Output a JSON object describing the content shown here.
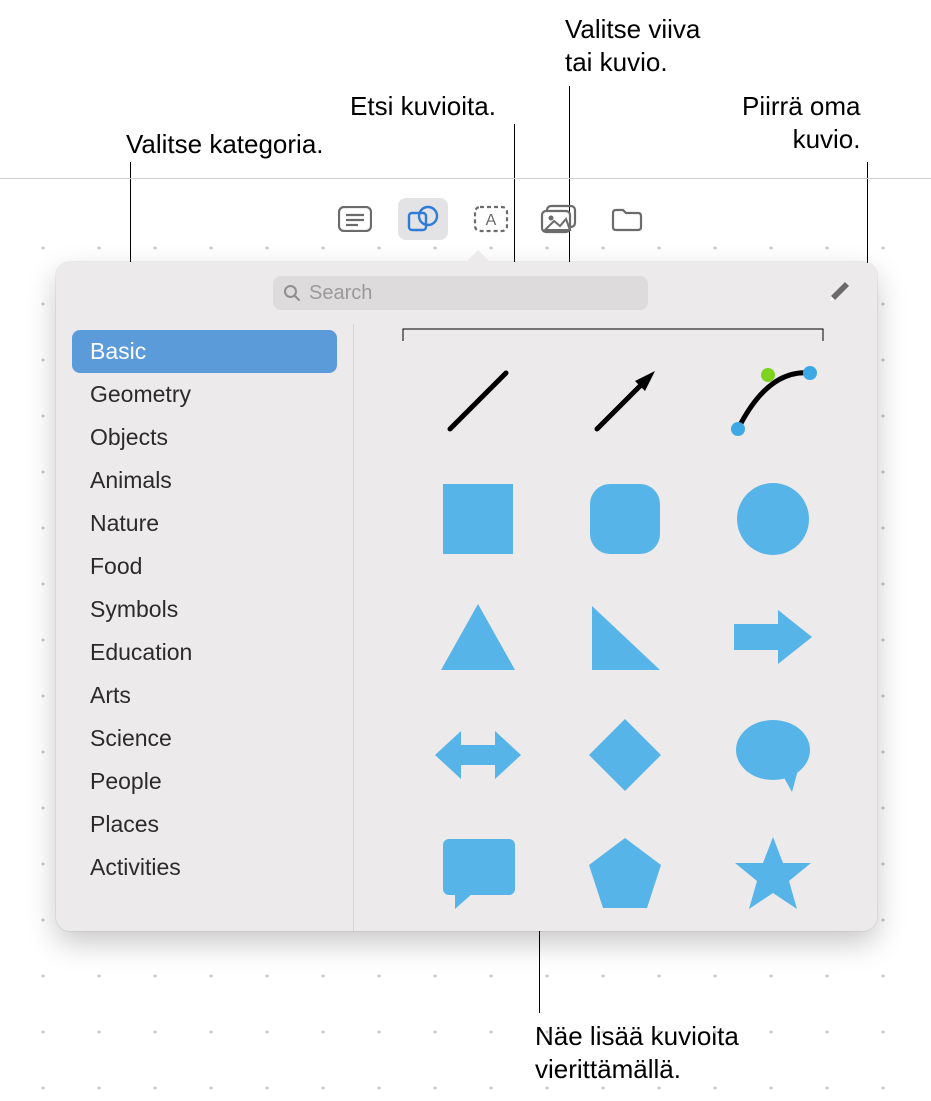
{
  "callouts": {
    "select_category": "Valitse kategoria.",
    "search_shapes": "Etsi kuvioita.",
    "select_line_or_shape": "Valitse viiva\ntai kuvio.",
    "draw_own_shape": "Piirrä oma\nkuvio.",
    "scroll_more": "Näe lisää kuvioita\nvierittämällä."
  },
  "toolbar": {
    "items": [
      {
        "name": "list-icon"
      },
      {
        "name": "shapes-icon"
      },
      {
        "name": "text-icon"
      },
      {
        "name": "media-icon"
      },
      {
        "name": "folder-icon"
      }
    ],
    "active_index": 1
  },
  "search": {
    "placeholder": "Search",
    "value": ""
  },
  "sidebar": {
    "categories": [
      "Basic",
      "Geometry",
      "Objects",
      "Animals",
      "Nature",
      "Food",
      "Symbols",
      "Education",
      "Arts",
      "Science",
      "People",
      "Places",
      "Activities"
    ],
    "selected_index": 0
  },
  "shapes": [
    "line",
    "arrow-line",
    "curve",
    "square",
    "rounded-square",
    "circle",
    "triangle",
    "right-triangle",
    "arrow-right",
    "double-arrow",
    "diamond",
    "speech-bubble",
    "callout-rect",
    "pentagon",
    "star"
  ],
  "colors": {
    "shape_fill": "#57b4e9",
    "accent": "#5b9bd9"
  }
}
